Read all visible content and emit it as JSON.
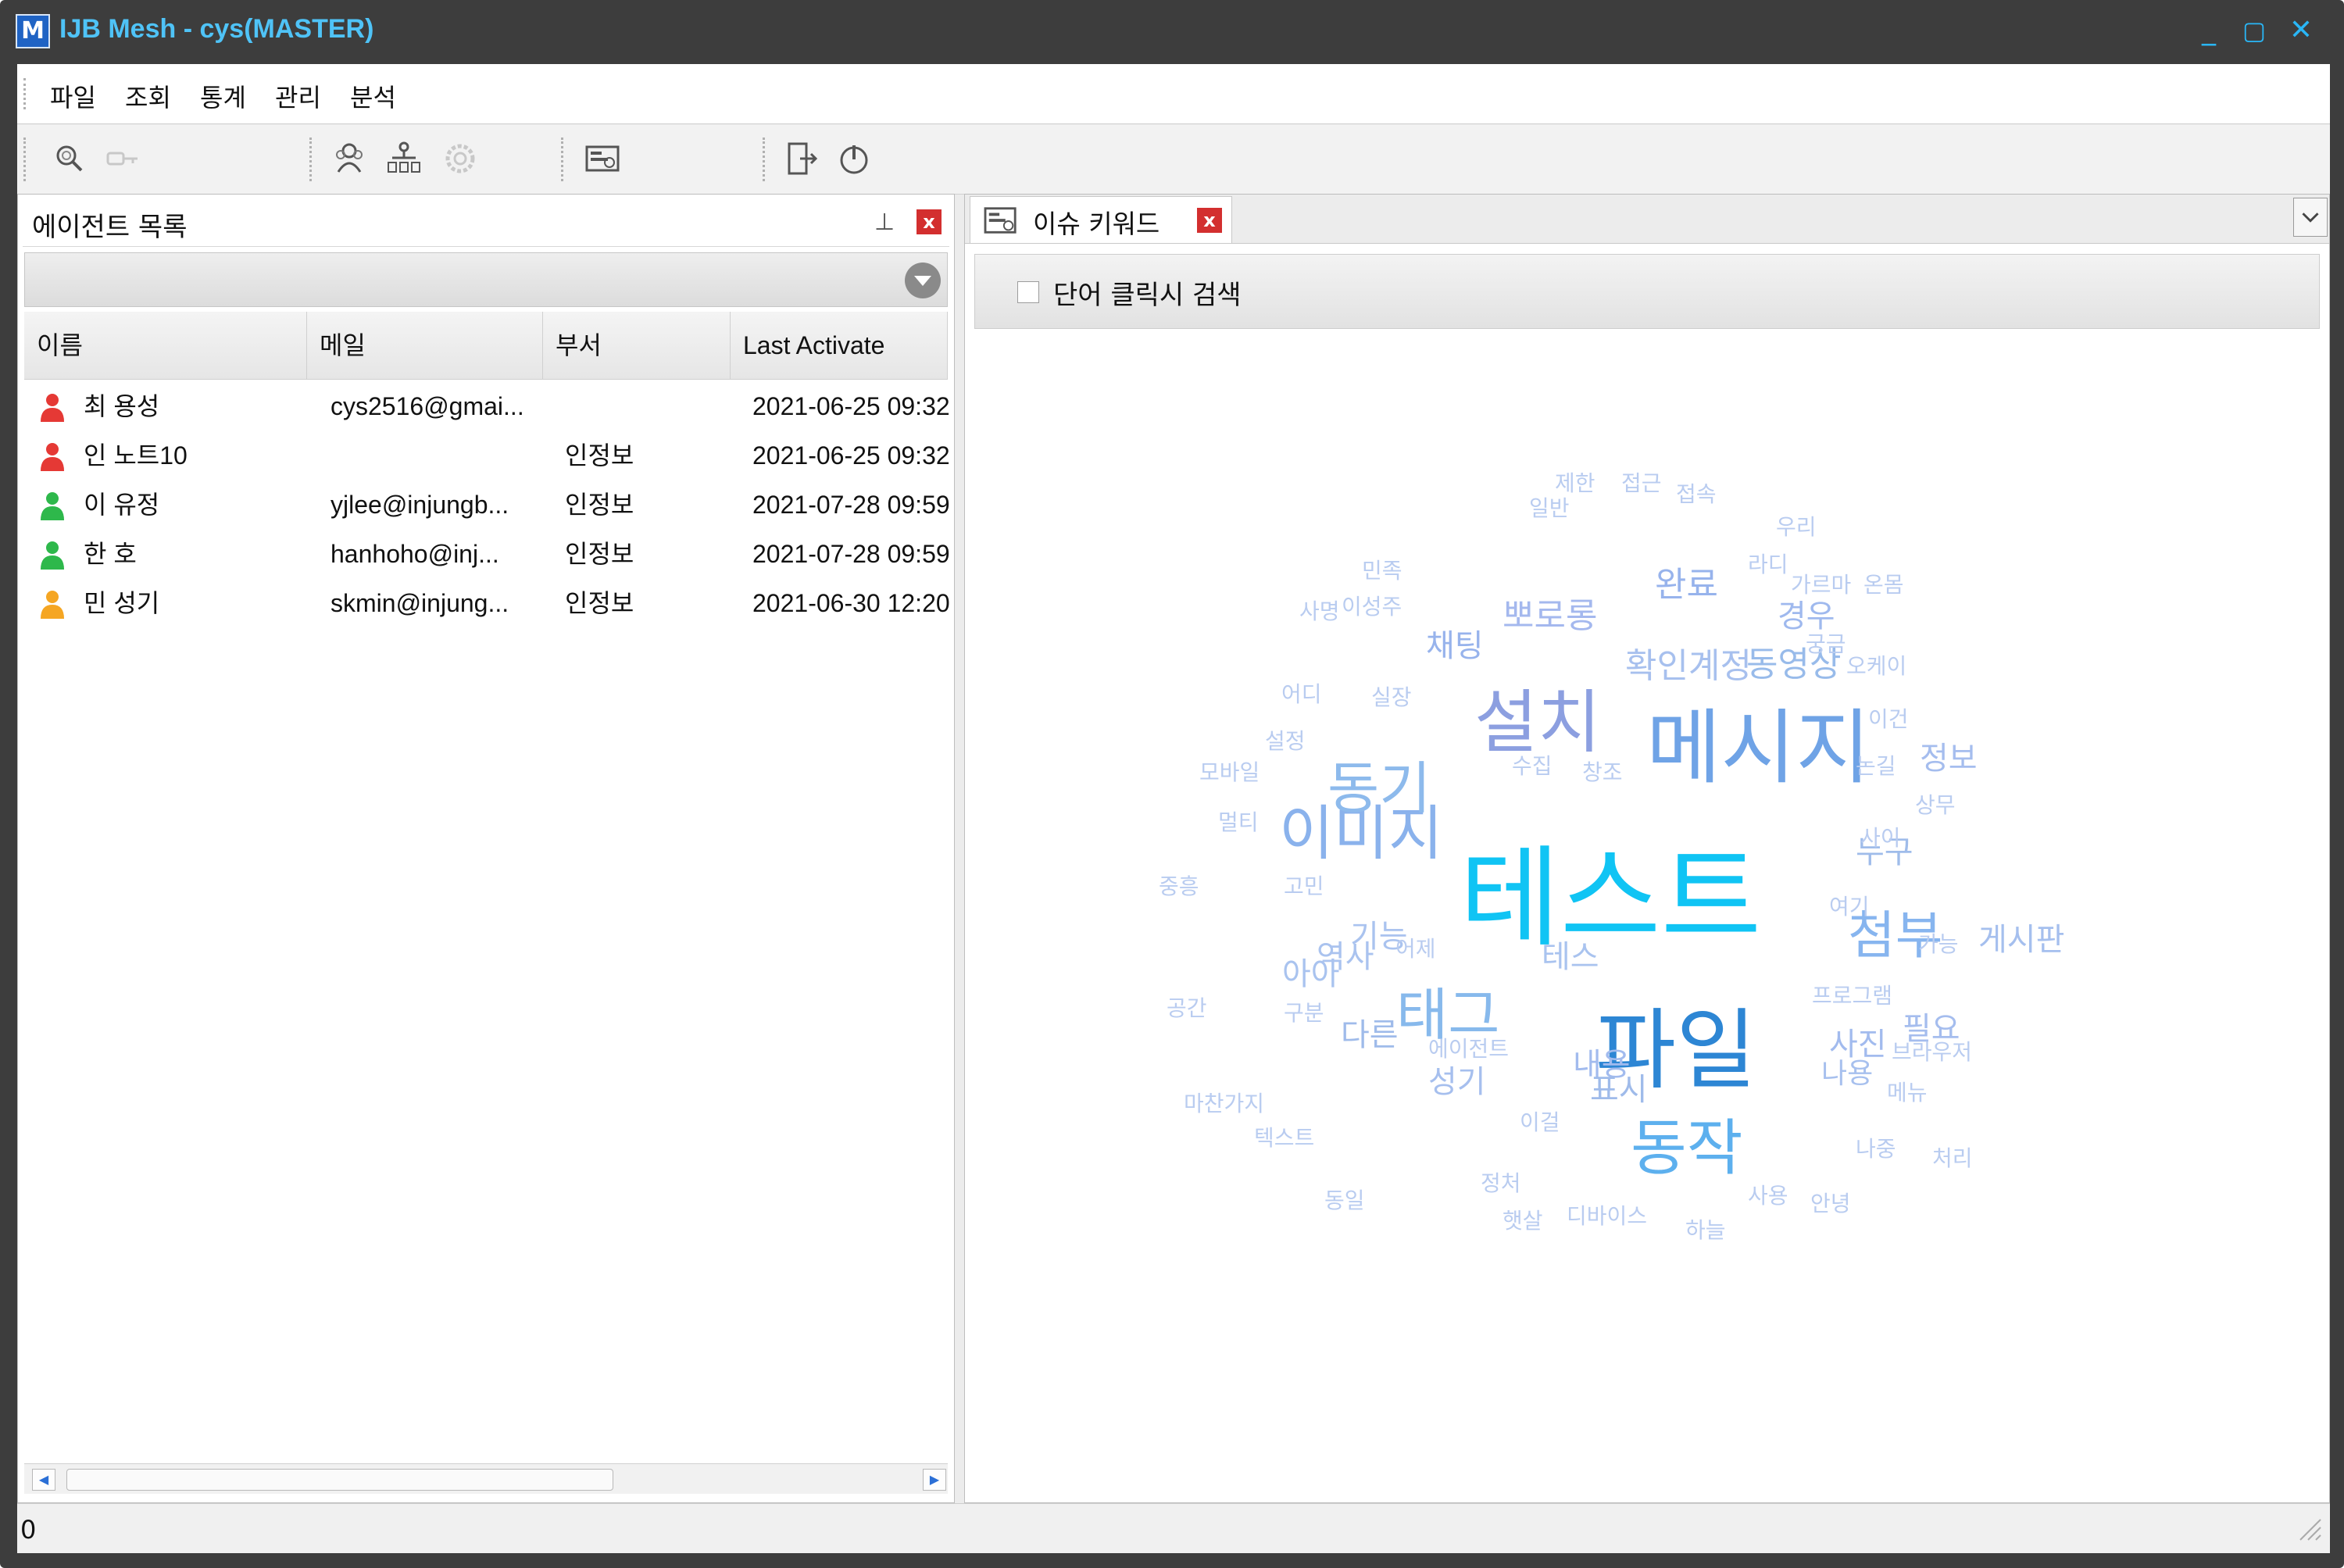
{
  "window": {
    "logo": "M",
    "title": "IJB Mesh - cys(MASTER)",
    "controls": {
      "minimize": "_",
      "maximize": "▢",
      "close": "✕"
    }
  },
  "menu": [
    "파일",
    "조회",
    "통계",
    "관리",
    "분석"
  ],
  "toolbar": {
    "icons": [
      "search-icon",
      "key-icon",
      "users-icon",
      "org-chart-icon",
      "gear-icon",
      "keyword-report-icon",
      "logout-icon",
      "power-icon"
    ]
  },
  "agent_panel": {
    "title": "에이전트 목록",
    "pin": "⊥",
    "close": "x",
    "columns": [
      "이름",
      "메일",
      "부서",
      "Last Activate"
    ],
    "rows": [
      {
        "name": "최 용성",
        "email": "cys2516@gmai...",
        "dept": "",
        "last": "2021-06-25 09:32",
        "status_color": "#e53935"
      },
      {
        "name": "인 노트10",
        "email": "",
        "dept": "인정보",
        "last": "2021-06-25 09:32",
        "status_color": "#e53935"
      },
      {
        "name": "이 유정",
        "email": "yjlee@injungb...",
        "dept": "인정보",
        "last": "2021-07-28 09:59",
        "status_color": "#2eb84b"
      },
      {
        "name": "한 호",
        "email": "hanhoho@inj...",
        "dept": "인정보",
        "last": "2021-07-28 09:59",
        "status_color": "#2eb84b"
      },
      {
        "name": "민 성기",
        "email": "skmin@injung...",
        "dept": "인정보",
        "last": "2021-06-30 12:20",
        "status_color": "#f5a623"
      }
    ],
    "scroll_left": "◀",
    "scroll_right": "▶"
  },
  "keyword_panel": {
    "tab_label": "이슈 키워드",
    "tab_close": "x",
    "search_option_label": "단어 클릭시 검색",
    "search_option_checked": false,
    "words": [
      {
        "text": "테스트",
        "color": "#10c4f4"
      },
      {
        "text": "파일",
        "color": "#2d86d4"
      },
      {
        "text": "메시지",
        "color": "#6fa3e6"
      },
      {
        "text": "설치",
        "color": "#8c9fe0"
      },
      {
        "text": "동작",
        "color": "#5db0ee"
      },
      {
        "text": "이미지",
        "color": "#8ab2ec"
      },
      {
        "text": "태그",
        "color": "#87b9ec"
      },
      {
        "text": "동기",
        "color": "#8dbaec"
      },
      {
        "text": "첨부",
        "color": "#87b5ef"
      },
      {
        "text": "확인계정",
        "color": "#a7c0ee"
      },
      {
        "text": "동영상",
        "color": "#98bbea"
      },
      {
        "text": "뽀로롱",
        "color": "#a4b8ee"
      },
      {
        "text": "완료",
        "color": "#97b3ec"
      },
      {
        "text": "경우",
        "color": "#9fb9ee"
      },
      {
        "text": "채팅",
        "color": "#97b3ec"
      },
      {
        "text": "정보",
        "color": "#a5bdee"
      },
      {
        "text": "누구",
        "color": "#9fbcea"
      },
      {
        "text": "게시판",
        "color": "#a5bfee"
      },
      {
        "text": "아아",
        "color": "#a9c3ef"
      },
      {
        "text": "기능",
        "color": "#aac3ef"
      },
      {
        "text": "역사",
        "color": "#aac3ef"
      },
      {
        "text": "테스",
        "color": "#a9c3ef"
      },
      {
        "text": "다른",
        "color": "#9fbbea"
      },
      {
        "text": "내용",
        "color": "#a2bbee"
      },
      {
        "text": "표시",
        "color": "#9fbbea"
      },
      {
        "text": "성기",
        "color": "#a6bfee"
      },
      {
        "text": "사진",
        "color": "#a2bbee"
      },
      {
        "text": "나용",
        "color": "#a7c0ee"
      },
      {
        "text": "필요",
        "color": "#a5bdee"
      },
      {
        "text": "제한",
        "color": "#b9ccf0"
      },
      {
        "text": "접근",
        "color": "#b9ccf0"
      },
      {
        "text": "접속",
        "color": "#b9ccf0"
      },
      {
        "text": "일반",
        "color": "#b9ccf0"
      },
      {
        "text": "우리",
        "color": "#b9ccf0"
      },
      {
        "text": "민족",
        "color": "#b9ccf0"
      },
      {
        "text": "라디",
        "color": "#b9ccf0"
      },
      {
        "text": "가르마",
        "color": "#b9ccf0"
      },
      {
        "text": "온몸",
        "color": "#b9ccf0"
      },
      {
        "text": "사명",
        "color": "#b9ccf0"
      },
      {
        "text": "이성주",
        "color": "#b9ccf0"
      },
      {
        "text": "궁금",
        "color": "#b9ccf0"
      },
      {
        "text": "오케이",
        "color": "#b9ccf0"
      },
      {
        "text": "어디",
        "color": "#b9ccf0"
      },
      {
        "text": "실장",
        "color": "#b9ccf0"
      },
      {
        "text": "이건",
        "color": "#b9ccf0"
      },
      {
        "text": "설정",
        "color": "#b9ccf0"
      },
      {
        "text": "논길",
        "color": "#b9ccf0"
      },
      {
        "text": "모바일",
        "color": "#b9ccf0"
      },
      {
        "text": "수집",
        "color": "#b9ccf0"
      },
      {
        "text": "창조",
        "color": "#b9ccf0"
      },
      {
        "text": "상무",
        "color": "#b9ccf0"
      },
      {
        "text": "멀티",
        "color": "#b9ccf0"
      },
      {
        "text": "사이",
        "color": "#b9ccf0"
      },
      {
        "text": "중흥",
        "color": "#b9ccf0"
      },
      {
        "text": "고민",
        "color": "#b9ccf0"
      },
      {
        "text": "여기",
        "color": "#b9ccf0"
      },
      {
        "text": "가능",
        "color": "#b9ccf0"
      },
      {
        "text": "어제",
        "color": "#b9ccf0"
      },
      {
        "text": "프로그램",
        "color": "#b9ccf0"
      },
      {
        "text": "공간",
        "color": "#b9ccf0"
      },
      {
        "text": "구분",
        "color": "#b9ccf0"
      },
      {
        "text": "브라우저",
        "color": "#b9ccf0"
      },
      {
        "text": "에이전트",
        "color": "#b9ccf0"
      },
      {
        "text": "메뉴",
        "color": "#b9ccf0"
      },
      {
        "text": "마찬가지",
        "color": "#b9ccf0"
      },
      {
        "text": "이걸",
        "color": "#b9ccf0"
      },
      {
        "text": "텍스트",
        "color": "#b9ccf0"
      },
      {
        "text": "나중",
        "color": "#b9ccf0"
      },
      {
        "text": "처리",
        "color": "#b9ccf0"
      },
      {
        "text": "정처",
        "color": "#b9ccf0"
      },
      {
        "text": "동일",
        "color": "#b9ccf0"
      },
      {
        "text": "사용",
        "color": "#b9ccf0"
      },
      {
        "text": "안녕",
        "color": "#b9ccf0"
      },
      {
        "text": "햇살",
        "color": "#b9ccf0"
      },
      {
        "text": "디바이스",
        "color": "#b9ccf0"
      },
      {
        "text": "하늘",
        "color": "#b9ccf0"
      }
    ]
  },
  "status": {
    "text": "0"
  }
}
